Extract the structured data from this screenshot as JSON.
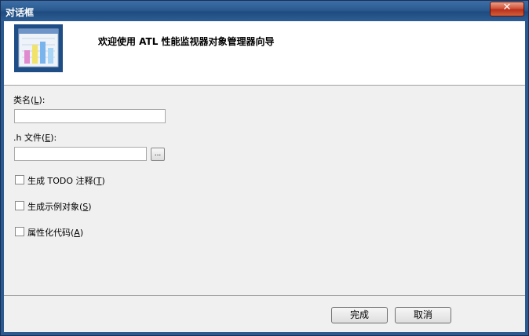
{
  "window": {
    "title": "对话框",
    "close_symbol": "✕"
  },
  "header": {
    "title": "欢迎使用 ATL 性能监视器对象管理器向导",
    "icon": "wizard-chart-icon"
  },
  "form": {
    "class_name_label": "类名",
    "class_name_mnemonic": "L",
    "class_name_value": "",
    "h_file_label": ".h 文件",
    "h_file_mnemonic": "E",
    "h_file_value": "",
    "browse_label": "...",
    "todo_checkbox_label": "生成 TODO 注释",
    "todo_mnemonic": "T",
    "sample_checkbox_label": "生成示例对象",
    "sample_mnemonic": "S",
    "attributed_checkbox_label": "属性化代码",
    "attributed_mnemonic": "A"
  },
  "buttons": {
    "finish": "完成",
    "cancel": "取消"
  }
}
